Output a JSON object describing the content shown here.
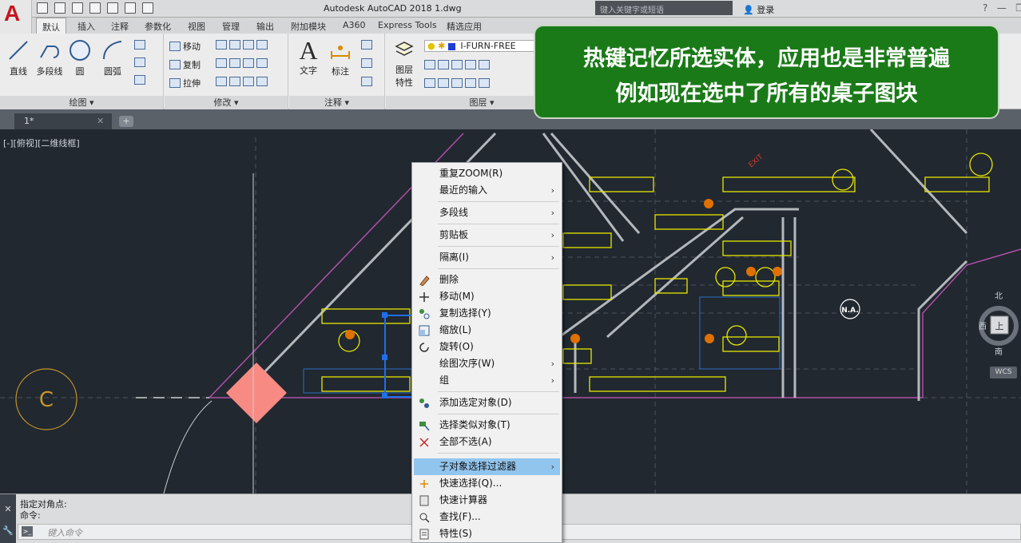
{
  "title": "Autodesk AutoCAD 2018    1.dwg",
  "search_placeholder": "键入关键字或短语",
  "login_label": "登录",
  "menu_tabs": [
    "默认",
    "插入",
    "注释",
    "参数化",
    "视图",
    "管理",
    "输出",
    "附加模块",
    "A360",
    "Express Tools",
    "精选应用"
  ],
  "ribbon": {
    "draw": {
      "label": "绘图 ▾",
      "line": "直线",
      "polyline": "多段线",
      "circle": "圆",
      "arc": "圆弧"
    },
    "modify": {
      "label": "修改 ▾",
      "move": "移动",
      "copy": "复制",
      "stretch": "拉伸"
    },
    "annotation": {
      "label": "注释 ▾",
      "text": "文字",
      "dimension": "标注"
    },
    "layers": {
      "label": "图层 ▾",
      "props": "图层\n特性",
      "current_layer": "I-FURN-FREE"
    }
  },
  "doc_tab": "1*",
  "view_label": "[-][俯视][二维线框]",
  "drawing_labels": {
    "circle_label": "C",
    "na_label": "N.A.",
    "exit_label": "EXIT",
    "compass_n": "北",
    "compass_w": "西",
    "compass_s": "南",
    "cube_face": "上",
    "wcs": "WCS"
  },
  "command": {
    "history1": "指定对角点:",
    "history2": "命令:",
    "placeholder": "键入命令"
  },
  "context_menu": [
    {
      "label": "重复ZOOM(R)",
      "submenu": false
    },
    {
      "label": "最近的输入",
      "submenu": true
    },
    {
      "label": "多段线",
      "submenu": true
    },
    {
      "label": "剪贴板",
      "submenu": true
    },
    {
      "label": "隔离(I)",
      "submenu": true
    },
    {
      "label": "删除",
      "submenu": false,
      "icon": "eraser-icon"
    },
    {
      "label": "移动(M)",
      "submenu": false,
      "icon": "move-icon"
    },
    {
      "label": "复制选择(Y)",
      "submenu": false,
      "icon": "copy-icon"
    },
    {
      "label": "缩放(L)",
      "submenu": false,
      "icon": "scale-icon"
    },
    {
      "label": "旋转(O)",
      "submenu": false,
      "icon": "rotate-icon"
    },
    {
      "label": "绘图次序(W)",
      "submenu": true
    },
    {
      "label": "组",
      "submenu": true
    },
    {
      "label": "添加选定对象(D)",
      "submenu": false,
      "icon": "add-selected-icon"
    },
    {
      "label": "选择类似对象(T)",
      "submenu": false,
      "icon": "select-similar-icon"
    },
    {
      "label": "全部不选(A)",
      "submenu": false,
      "icon": "deselect-icon"
    },
    {
      "label": "子对象选择过滤器",
      "submenu": true,
      "highlighted": true
    },
    {
      "label": "快速选择(Q)...",
      "submenu": false,
      "icon": "quick-select-icon"
    },
    {
      "label": "快速计算器",
      "submenu": false,
      "icon": "calculator-icon"
    },
    {
      "label": "查找(F)...",
      "submenu": false,
      "icon": "find-icon"
    },
    {
      "label": "特性(S)",
      "submenu": false,
      "icon": "properties-icon"
    }
  ],
  "overlay": {
    "line1": "热键记忆所选实体，应用也是非常普遍",
    "line2": "例如现在选中了所有的桌子图块"
  },
  "colors": {
    "canvas": "#212830",
    "furniture": "#e6e600",
    "walls": "#b4b8bc",
    "selection": "#1e6fe8",
    "highlight": "#92c5ee",
    "overlay_bg": "#1a7a18",
    "magenta": "#b04fa6",
    "grip": "#f78a83"
  }
}
